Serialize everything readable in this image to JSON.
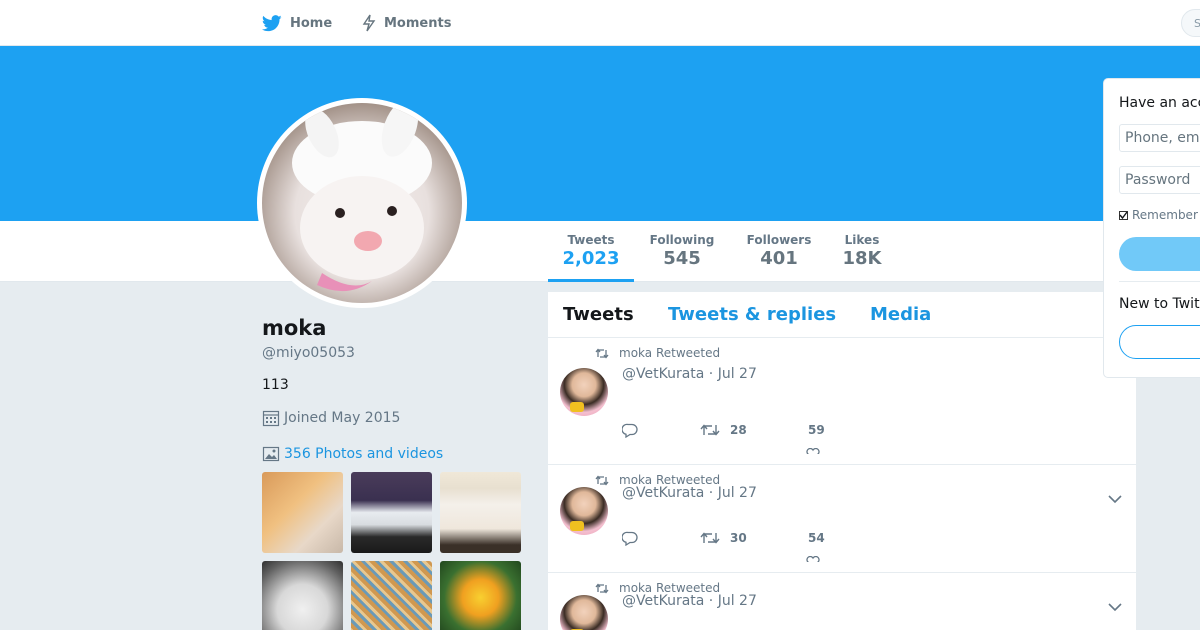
{
  "nav": {
    "home_label": "Home",
    "moments_label": "Moments",
    "search_placeholder": "S"
  },
  "stats": [
    {
      "label": "Tweets",
      "value": "2,023"
    },
    {
      "label": "Following",
      "value": "545"
    },
    {
      "label": "Followers",
      "value": "401"
    },
    {
      "label": "Likes",
      "value": "18K"
    }
  ],
  "profile": {
    "name": "moka",
    "handle": "@miyo05053",
    "bio": "113",
    "joined": "Joined May 2015",
    "photos_link": "356 Photos and videos"
  },
  "timeline": {
    "tabs": [
      "Tweets",
      "Tweets & replies",
      "Media"
    ],
    "tweets": [
      {
        "retweet_label": "moka Retweeted",
        "header": "@VetKurata · Jul 27",
        "retweets": "28",
        "likes": "59"
      },
      {
        "retweet_label": "moka Retweeted",
        "header": "@VetKurata · Jul 27",
        "retweets": "30",
        "likes": "54"
      },
      {
        "retweet_label": "moka Retweeted",
        "header": "@VetKurata · Jul 27"
      }
    ]
  },
  "login": {
    "title": "Have an acc",
    "phone_placeholder": "Phone, ema",
    "password_placeholder": "Password",
    "remember_label": "Remember",
    "new_to": "New to Twit"
  },
  "colors": {
    "brand": "#1da1f2",
    "link": "#1b95e0",
    "muted": "#657786",
    "background": "#e6ecf0"
  }
}
